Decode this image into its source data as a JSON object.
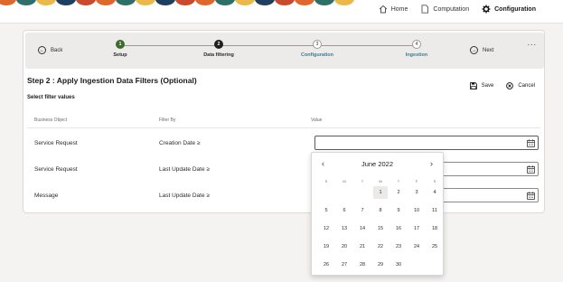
{
  "nav": {
    "home": "Home",
    "computation": "Computation",
    "configuration": "Configuration"
  },
  "train": {
    "back": "Back",
    "next": "Next",
    "more": "...",
    "steps": [
      {
        "num": "1",
        "label": "Setup",
        "state": "done"
      },
      {
        "num": "2",
        "label": "Data filtering",
        "state": "current"
      },
      {
        "num": "3",
        "label": "Configuration",
        "state": "todo"
      },
      {
        "num": "4",
        "label": "Ingestion",
        "state": "todo"
      }
    ]
  },
  "page": {
    "title": "Step 2 : Apply Ingestion Data Filters (Optional)",
    "subtitle": "Select filter values"
  },
  "actions": {
    "save": "Save",
    "cancel": "Cancel"
  },
  "table": {
    "headers": [
      "Business Object",
      "Filter By",
      "Value"
    ],
    "rows": [
      {
        "object": "Service Request",
        "filter": "Creation Date  ≥",
        "value": ""
      },
      {
        "object": "Service Request",
        "filter": "Last Update Date  ≥",
        "value": ""
      },
      {
        "object": "Message",
        "filter": "Last Update Date  ≥",
        "value": ""
      }
    ]
  },
  "datepicker": {
    "month": "June 2022",
    "prev": "‹",
    "next": "›",
    "weekdays": [
      "S",
      "M",
      "T",
      "W",
      "T",
      "F",
      "S"
    ],
    "first_weekday_index": 3,
    "days": [
      "1",
      "2",
      "3",
      "4",
      "5",
      "6",
      "7",
      "8",
      "9",
      "10",
      "11",
      "12",
      "13",
      "14",
      "15",
      "16",
      "17",
      "18",
      "19",
      "20",
      "21",
      "22",
      "23",
      "24",
      "25",
      "26",
      "27",
      "28",
      "29",
      "30"
    ],
    "today": "1"
  },
  "colors": {
    "step_done": "#3c6b2a",
    "step_current": "#1f1f1f",
    "step_link": "#3e7c8f",
    "banner_accents": [
      "#e0672b",
      "#2f6f6a",
      "#e9b94a",
      "#1f3f5e",
      "#c94a2d"
    ]
  }
}
